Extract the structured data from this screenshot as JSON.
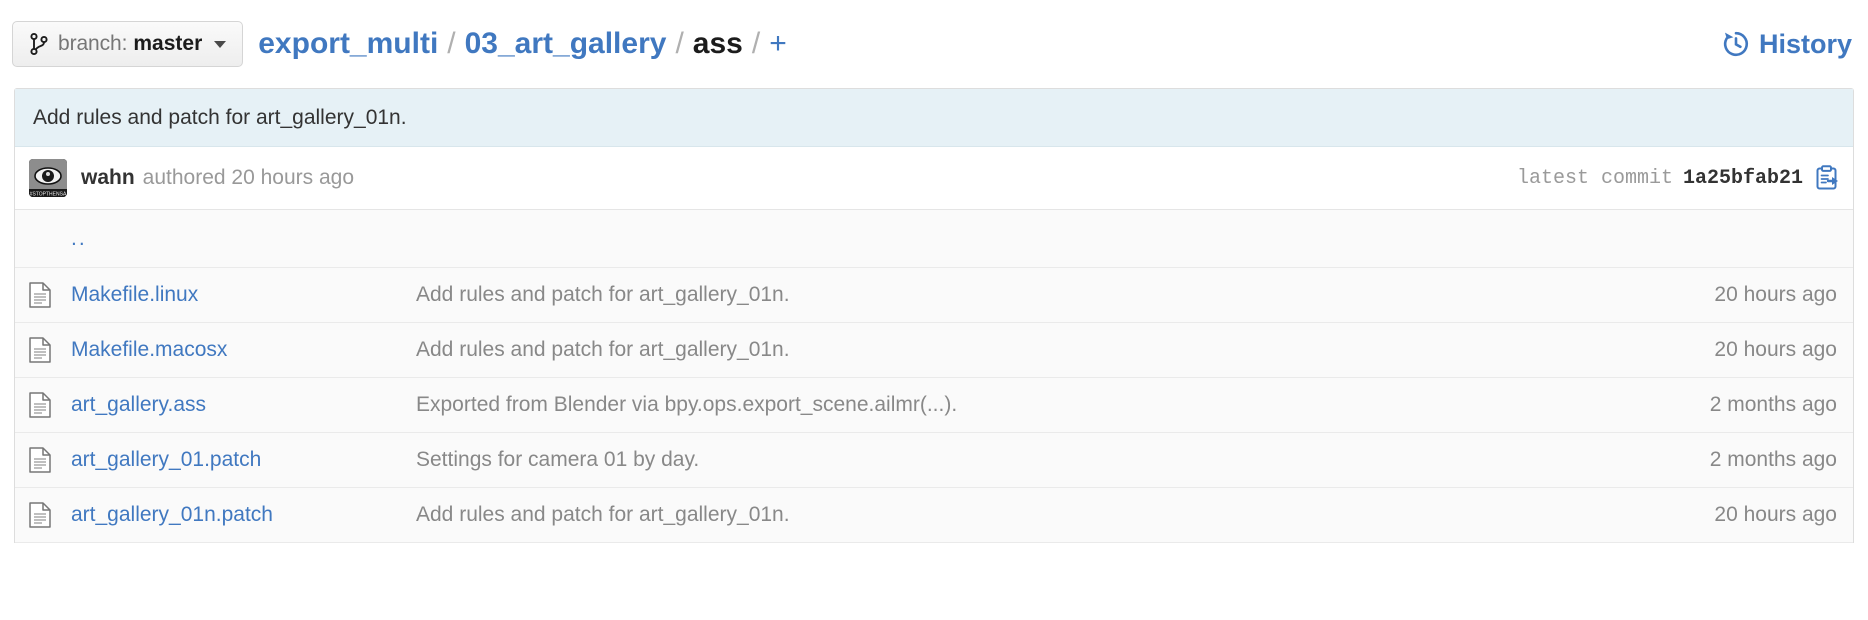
{
  "topbar": {
    "branch_button": {
      "icon": "git-branch-icon",
      "label": "branch:",
      "value": "master",
      "caret": "chevron-down-icon"
    },
    "breadcrumb": {
      "separator": "/",
      "items": [
        {
          "label": "export_multi",
          "type": "link"
        },
        {
          "label": "03_art_gallery",
          "type": "link"
        },
        {
          "label": "ass",
          "type": "current"
        }
      ],
      "add_label": "+"
    },
    "history": {
      "icon": "history-icon",
      "label": "History"
    }
  },
  "commit": {
    "message": "Add rules and patch for art_gallery_01n.",
    "avatar_icon": "user-avatar-eye-icon",
    "author": "wahn",
    "authored_text": "authored 20 hours ago",
    "latest_commit_label": "latest commit",
    "latest_commit_sha": "1a25bfab21",
    "copy_icon": "clipboard-copy-icon"
  },
  "files": {
    "parent_link": "..",
    "rows": [
      {
        "icon": "file-text-icon",
        "name": "Makefile.linux",
        "message": "Add rules and patch for art_gallery_01n.",
        "age": "20 hours ago"
      },
      {
        "icon": "file-text-icon",
        "name": "Makefile.macosx",
        "message": "Add rules and patch for art_gallery_01n.",
        "age": "20 hours ago"
      },
      {
        "icon": "file-text-icon",
        "name": "art_gallery.ass",
        "message": "Exported from Blender via bpy.ops.export_scene.ailmr(...).",
        "age": "2 months ago"
      },
      {
        "icon": "file-text-icon",
        "name": "art_gallery_01.patch",
        "message": "Settings for camera 01 by day.",
        "age": "2 months ago"
      },
      {
        "icon": "file-text-icon",
        "name": "art_gallery_01n.patch",
        "message": "Add rules and patch for art_gallery_01n.",
        "age": "20 hours ago"
      }
    ]
  },
  "colors": {
    "link": "#4078c0",
    "commit_message_bg": "#e6f1f6",
    "row_bg": "#fafafa",
    "muted_text": "#888888",
    "border": "#dddddd"
  }
}
